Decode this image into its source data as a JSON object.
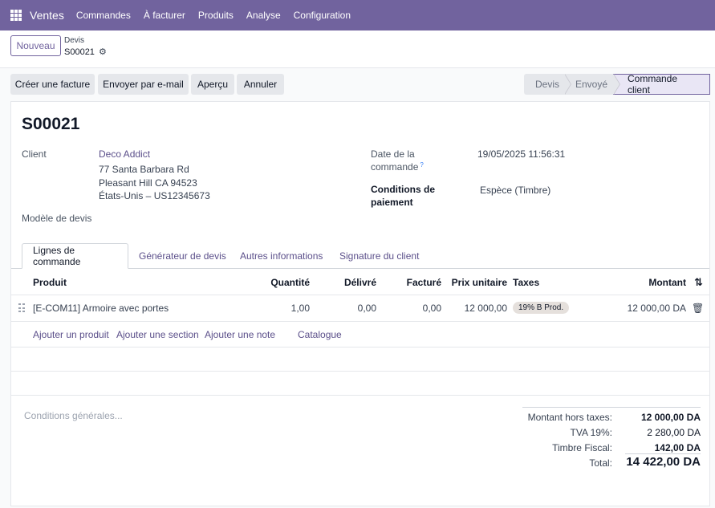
{
  "navbar": {
    "brand": "Ventes",
    "items": [
      "Commandes",
      "À facturer",
      "Produits",
      "Analyse",
      "Configuration"
    ]
  },
  "control": {
    "new_label": "Nouveau",
    "breadcrumb_parent": "Devis",
    "breadcrumb_current": "S00021"
  },
  "actions": {
    "create_invoice": "Créer une facture",
    "send_email": "Envoyer par e-mail",
    "preview": "Aperçu",
    "cancel": "Annuler"
  },
  "status": {
    "stages": [
      "Devis",
      "Envoyé",
      "Commande client"
    ],
    "active": "Commande client"
  },
  "form": {
    "title": "S00021",
    "client_label": "Client",
    "client_name": "Deco Addict",
    "client_address1": "77 Santa Barbara Rd",
    "client_address2": "Pleasant Hill CA 94523",
    "client_address3": "États-Unis – US12345673",
    "template_label": "Modèle de devis",
    "order_date_label1": "Date de la",
    "order_date_label2": "commande",
    "tooltip_mark": "?",
    "order_date_value": "19/05/2025 11:56:31",
    "payment_terms_label1": "Conditions de",
    "payment_terms_label2": "paiement",
    "payment_terms_value": "Espèce (Timbre)"
  },
  "tabs": [
    "Lignes de commande",
    "Générateur de devis",
    "Autres informations",
    "Signature du client"
  ],
  "table": {
    "headers": {
      "product": "Produit",
      "quantity": "Quantité",
      "delivered": "Délivré",
      "invoiced": "Facturé",
      "unit_price": "Prix unitaire",
      "taxes": "Taxes",
      "amount": "Montant"
    },
    "rows": [
      {
        "product": "[E-COM11] Armoire avec portes",
        "quantity": "1,00",
        "delivered": "0,00",
        "invoiced": "0,00",
        "unit_price": "12 000,00",
        "taxes": "19% B Prod.",
        "amount": "12 000,00 DA"
      }
    ],
    "add_links": [
      "Ajouter un produit",
      "Ajouter une section",
      "Ajouter une note",
      "Catalogue"
    ]
  },
  "terms_placeholder": "Conditions générales...",
  "totals": {
    "untaxed_label": "Montant hors taxes:",
    "untaxed_value": "12 000,00 DA",
    "vat_label": "TVA 19%:",
    "vat_value": "2 280,00 DA",
    "stamp_label": "Timbre Fiscal:",
    "stamp_value": "142,00 DA",
    "total_label": "Total:",
    "total_value": "14 422,00 DA"
  },
  "colors": {
    "brand": "#71639e",
    "link": "#5b4f8a"
  }
}
